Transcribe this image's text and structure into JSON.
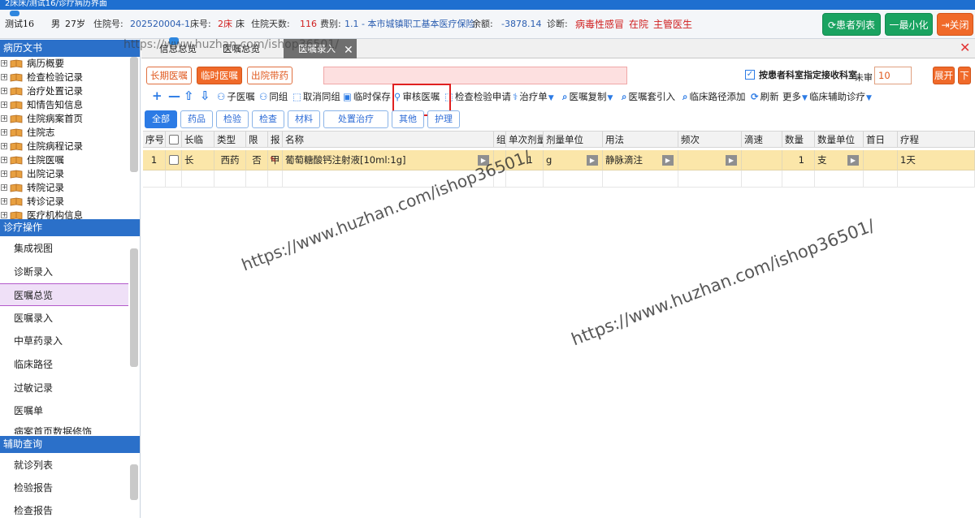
{
  "window": {
    "title": "2床床/测试16/诊疗病历界面"
  },
  "patient": {
    "name": "测试16",
    "gender": "男",
    "age": "27岁",
    "admission_no_label": "住院号:",
    "admission_no": "202520004-1",
    "bed_label": "床号:",
    "bed": "2床",
    "bed_suffix": "床",
    "days_label": "住院天数:",
    "days": "116",
    "fee_label": "费别:",
    "fee": "1.1 - 本市城镇职工基本医疗保险",
    "balance_label": "余额:",
    "balance": "-3878.14",
    "diagnosis_label": "诊断:",
    "diagnosis": "病毒性感冒",
    "status": "在院",
    "doctor": "主管医生"
  },
  "top_buttons": {
    "patient_list": "患者列表",
    "minimize": "一最小化",
    "close": "关闭"
  },
  "left": {
    "record_header": "病历文书",
    "record_items": [
      "病历概要",
      "检查检验记录",
      "治疗处置记录",
      "知情告知信息",
      "住院病案首页",
      "住院志",
      "住院病程记录",
      "住院医嘱",
      "出院记录",
      "转院记录",
      "转诊记录",
      "医疗机构信息"
    ],
    "ops_header": "诊疗操作",
    "ops_items": [
      "集成视图",
      "诊断录入",
      "医嘱总览",
      "医嘱录入",
      "中草药录入",
      "临床路径",
      "过敏记录",
      "医嘱单",
      "病案首页数据修饰"
    ],
    "assist_header": "辅助查询",
    "assist_items": [
      "就诊列表",
      "检验报告",
      "检查报告"
    ]
  },
  "tabs": [
    "信息总览",
    "医嘱总览",
    "医嘱录入"
  ],
  "order_buttons": {
    "long": "长期医嘱",
    "temp": "临时医嘱",
    "discharge": "出院带药"
  },
  "right_controls": {
    "dept_check_label": "按患者科室指定接收科室",
    "unreviewed_label": "未审",
    "unreviewed_value": "10",
    "expand": "展开",
    "down": "下"
  },
  "toolbar": {
    "sub_order": "子医嘱",
    "same_group": "同组",
    "cancel_group": "取消同组",
    "temp_save": "临时保存",
    "review": "审核医嘱",
    "lab_request": "检查检验申请",
    "treatment": "治疗单",
    "order_copy": "医嘱复制",
    "order_set": "医嘱套引入",
    "pathway_add": "临床路径添加",
    "refresh": "刷新",
    "more": "更多",
    "clinical_assist": "临床辅助诊疗"
  },
  "filter_tabs": [
    "全部",
    "药品",
    "检验",
    "检查",
    "材料",
    "处置治疗",
    "其他",
    "护理"
  ],
  "grid": {
    "columns": [
      "序号",
      "",
      "长临",
      "类型",
      "限",
      "报",
      "名称",
      "组",
      "单次剂量",
      "剂量单位",
      "用法",
      "频次",
      "滴速",
      "数量",
      "数量单位",
      "首日",
      "疗程"
    ],
    "rows": [
      {
        "no": "1",
        "type_lt": "长",
        "category": "西药",
        "limit": "否",
        "report": "甲",
        "name": "葡萄糖酸钙注射液[10ml:1g]",
        "group": "",
        "dose": "1",
        "dose_unit": "g",
        "usage": "静脉滴注",
        "freq": "",
        "drip": "",
        "qty": "1",
        "qty_unit": "支",
        "first_day": "",
        "course": "1天"
      }
    ]
  },
  "watermark": "https://www.huzhan.com/ishop36501/"
}
